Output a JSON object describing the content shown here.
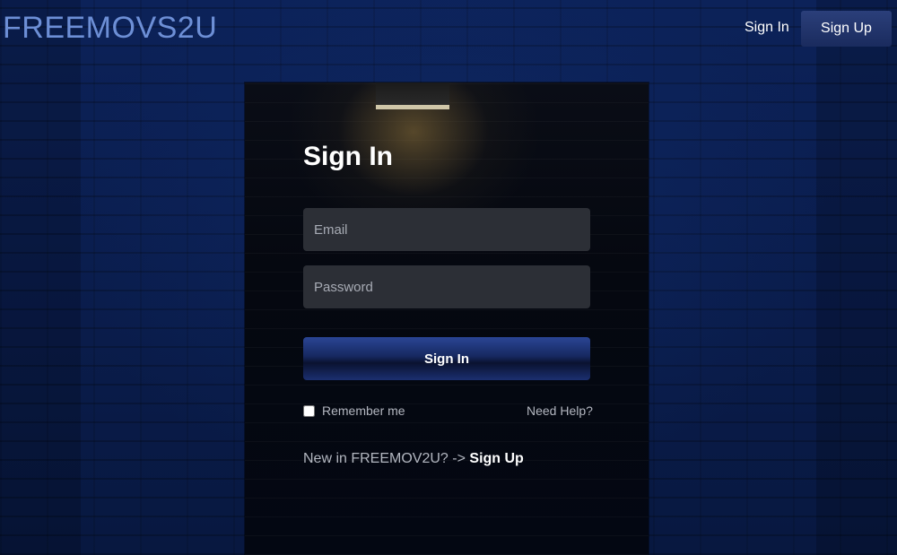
{
  "header": {
    "logo": "FREEMOVS2U",
    "sign_in_label": "Sign In",
    "sign_up_label": "Sign Up"
  },
  "form": {
    "title": "Sign In",
    "email_placeholder": "Email",
    "password_placeholder": "Password",
    "submit_label": "Sign In",
    "remember_label": "Remember me",
    "remember_checked": false,
    "help_label": "Need Help?",
    "new_prefix": "New in FREEMOV2U? ->",
    "signup_link": "Sign Up"
  },
  "colors": {
    "background": "#0b1e4e",
    "logo": "#6d8fd6",
    "accent": "#1a2b5e",
    "field": "#2c2f36"
  }
}
